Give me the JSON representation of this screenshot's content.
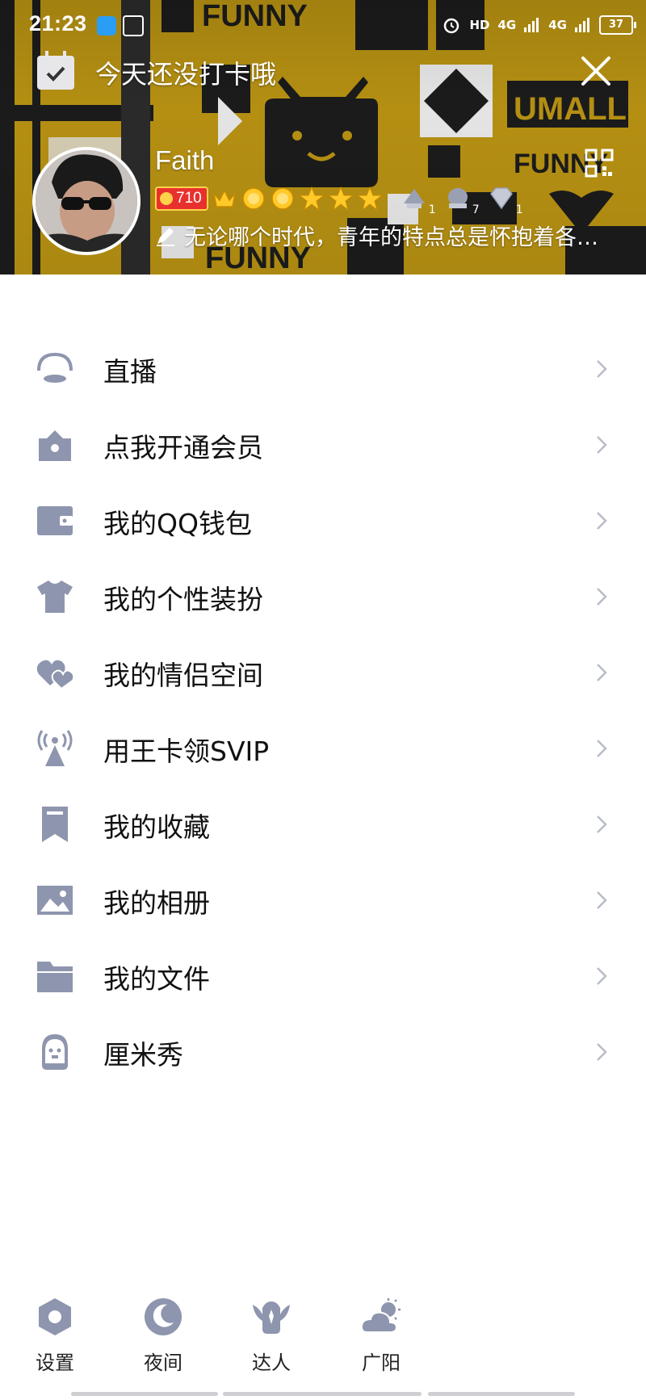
{
  "status_bar": {
    "time": "21:23",
    "indicators": [
      "alarm-icon",
      "HD",
      "4G",
      "4G"
    ],
    "battery": "37"
  },
  "header": {
    "checkin_label": "今天还没打卡哦",
    "nickname": "Faith",
    "level": "710",
    "badge_counts": [
      "1",
      "7",
      "1"
    ],
    "signature": "无论哪个时代，青年的特点总是怀抱着各…"
  },
  "menu": {
    "items": [
      {
        "label": "直播",
        "icon": "live-icon"
      },
      {
        "label": "点我开通会员",
        "icon": "vip-icon"
      },
      {
        "label": "我的QQ钱包",
        "icon": "wallet-icon"
      },
      {
        "label": "我的个性装扮",
        "icon": "shirt-icon"
      },
      {
        "label": "我的情侣空间",
        "icon": "hearts-icon"
      },
      {
        "label": "用王卡领SVIP",
        "icon": "antenna-icon"
      },
      {
        "label": "我的收藏",
        "icon": "bookmark-icon"
      },
      {
        "label": "我的相册",
        "icon": "photo-icon"
      },
      {
        "label": "我的文件",
        "icon": "folder-icon"
      },
      {
        "label": "厘米秀",
        "icon": "cmshow-icon"
      }
    ]
  },
  "bottom_bar": {
    "settings": "设置",
    "night": "夜间",
    "expert": "达人",
    "weather": "广阳"
  },
  "colors": {
    "icon_gray": "#8e95ae",
    "banner_yellow": "#b48f12",
    "level_red": "#e8312e"
  }
}
